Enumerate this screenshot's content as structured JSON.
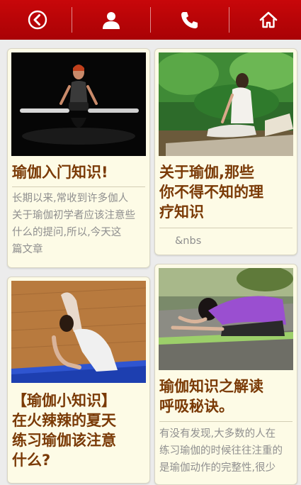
{
  "nav": {
    "items": [
      {
        "icon": "back-circle-icon"
      },
      {
        "icon": "user-icon"
      },
      {
        "icon": "phone-icon"
      },
      {
        "icon": "home-icon"
      }
    ]
  },
  "cards": [
    {
      "title": "瑜伽入门知识!",
      "desc": "长期以来,常收到许多伽人\n关于瑜伽初学者应该注意些\n什么的提问,所以,今天这\n篇文章"
    },
    {
      "title": "关于瑜伽,那些\n你不得不知的理\n疗知识",
      "desc": "&nbs"
    },
    {
      "title": "【瑜伽小知识】\n在火辣辣的夏天\n练习瑜伽该注意\n什么?",
      "desc": ""
    },
    {
      "title": "瑜伽知识之解读\n呼吸秘诀。",
      "desc": "有没有发现,大多数的人在\n练习瑜伽的时候往往注重的\n是瑜伽动作的完整性,很少"
    }
  ],
  "colors": {
    "header_red": "#b80306",
    "card_bg": "#fdfbe6",
    "title_brown": "#7a3a06",
    "desc_gray": "#8f8f8f"
  }
}
